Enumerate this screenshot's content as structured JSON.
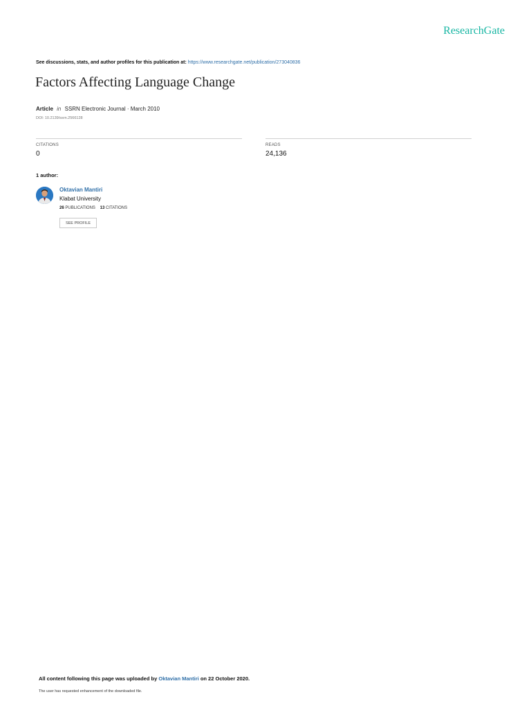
{
  "brand": "ResearchGate",
  "header": {
    "discuss_text": "See discussions, stats, and author profiles for this publication at:",
    "publication_url": "https://www.researchgate.net/publication/273040836"
  },
  "article": {
    "title": "Factors Affecting Language Change",
    "type": "Article",
    "in_label": "in",
    "journal_date": "SSRN Electronic Journal · March 2010",
    "doi": "DOI: 10.2139/ssrn.2566128"
  },
  "stats": {
    "citations_label": "CITATIONS",
    "citations_value": "0",
    "reads_label": "READS",
    "reads_value": "24,136"
  },
  "authors": {
    "heading": "1 author:",
    "list": [
      {
        "name": "Oktavian Mantiri",
        "affiliation": "Klabat University",
        "publications_count": "26",
        "publications_label": "PUBLICATIONS",
        "citations_count": "13",
        "citations_label": "CITATIONS",
        "profile_button": "SEE PROFILE"
      }
    ]
  },
  "footer": {
    "upload_prefix": "All content following this page was uploaded by",
    "uploader": "Oktavian Mantiri",
    "upload_suffix": "on 22 October 2020.",
    "note": "The user has requested enhancement of the downloaded file."
  },
  "colors": {
    "brand": "#17b6a3",
    "link": "#2f6fa8",
    "avatar_bg": "#2b78c2"
  }
}
